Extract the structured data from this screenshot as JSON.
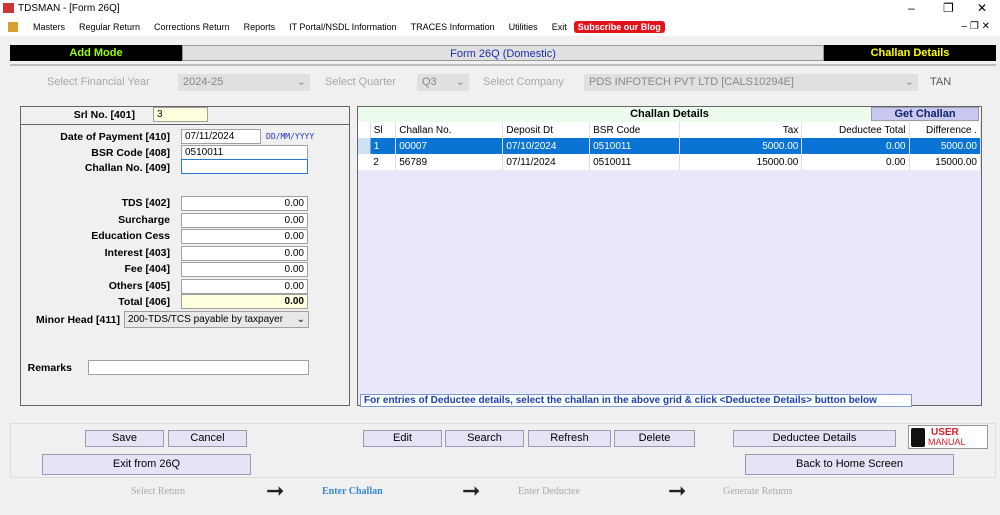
{
  "window": {
    "title": "TDSMAN - [Form 26Q]",
    "min": "–",
    "max": "❐",
    "close": "✕"
  },
  "menu": [
    "Masters",
    "Regular Return",
    "Corrections Return",
    "Reports",
    "IT Portal/NSDL Information",
    "TRACES Information",
    "Utilities",
    "Exit"
  ],
  "blog": "Subscribe our Blog",
  "header": {
    "mode": "Add Mode",
    "form": "Form 26Q (Domestic)",
    "section": "Challan Details"
  },
  "selectors": {
    "fy_label": "Select Financial Year",
    "fy": "2024-25",
    "q_label": "Select Quarter",
    "q": "Q3",
    "company_label": "Select Company",
    "company": "PDS INFOTECH PVT LTD [CALS10294E]",
    "tan": "TAN"
  },
  "form": {
    "srl_label": "Srl No. [401]",
    "srl": "3",
    "dop_label": "Date of Payment [410]",
    "dop": "07/11/2024",
    "dop_hint": "DD/MM/YYYY",
    "bsr_label": "BSR Code [408]",
    "bsr": "0510011",
    "challan_label": "Challan No. [409]",
    "challan": "",
    "amounts": [
      {
        "label": "TDS [402]",
        "value": "0.00"
      },
      {
        "label": "Surcharge",
        "value": "0.00"
      },
      {
        "label": "Education Cess",
        "value": "0.00"
      },
      {
        "label": "Interest [403]",
        "value": "0.00"
      },
      {
        "label": "Fee [404]",
        "value": "0.00"
      },
      {
        "label": "Others [405]",
        "value": "0.00"
      }
    ],
    "total_label": "Total [406]",
    "total": "0.00",
    "minor_label": "Minor Head [411]",
    "minor": "200-TDS/TCS payable by taxpayer",
    "remarks_label": "Remarks",
    "remarks": ""
  },
  "grid": {
    "title": "Challan Details",
    "get_btn": "Get Challan",
    "columns": [
      "Sl",
      "Challan No.",
      "Deposit Dt",
      "BSR Code",
      "Tax",
      "Deductee Total",
      "Difference ."
    ],
    "rows": [
      [
        "1",
        "00007",
        "07/10/2024",
        "0510011",
        "5000.00",
        "0.00",
        "5000.00"
      ],
      [
        "2",
        "56789",
        "07/11/2024",
        "0510011",
        "15000.00",
        "0.00",
        "15000.00"
      ]
    ],
    "hint": "For entries of Deductee details, select the challan in the above grid & click <Deductee Details> button below"
  },
  "buttons": {
    "save": "Save",
    "cancel": "Cancel",
    "edit": "Edit",
    "search": "Search",
    "refresh": "Refresh",
    "delete": "Delete",
    "deductee": "Deductee Details",
    "exit": "Exit from 26Q",
    "home": "Back to Home Screen",
    "manual1": "USER",
    "manual2": "MANUAL"
  },
  "steps": [
    "Select Return",
    "Enter Challan",
    "Enter Deductee",
    "Generate Returns"
  ]
}
